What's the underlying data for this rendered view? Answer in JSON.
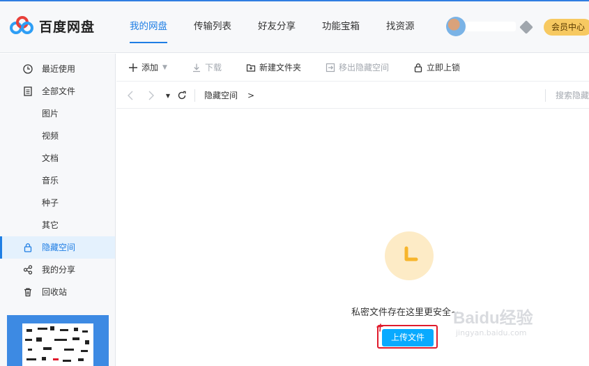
{
  "app": {
    "name": "百度网盘"
  },
  "nav": {
    "tabs": [
      {
        "label": "我的网盘",
        "active": true
      },
      {
        "label": "传输列表",
        "active": false
      },
      {
        "label": "好友分享",
        "active": false
      },
      {
        "label": "功能宝箱",
        "active": false
      },
      {
        "label": "找资源",
        "active": false
      }
    ],
    "vip_label": "会员中心"
  },
  "sidebar": {
    "items": [
      {
        "label": "最近使用",
        "icon": "clock-icon"
      },
      {
        "label": "全部文件",
        "icon": "document-icon"
      },
      {
        "label": "图片"
      },
      {
        "label": "视频"
      },
      {
        "label": "文档"
      },
      {
        "label": "音乐"
      },
      {
        "label": "种子"
      },
      {
        "label": "其它"
      },
      {
        "label": "隐藏空间",
        "icon": "lock-icon",
        "active": true
      },
      {
        "label": "我的分享",
        "icon": "share-icon"
      },
      {
        "label": "回收站",
        "icon": "trash-icon"
      }
    ]
  },
  "toolbar": {
    "add": "添加",
    "download": "下载",
    "new_folder": "新建文件夹",
    "move_out": "移出隐藏空间",
    "lock_now": "立即上锁"
  },
  "path": {
    "current": "隐藏空间",
    "separator": ">",
    "search_placeholder": "搜索隐藏"
  },
  "empty_state": {
    "message": "私密文件存在这里更安全~",
    "upload_label": "上传文件"
  },
  "watermark": {
    "brand": "Baidu经验",
    "url": "jingyan.baidu.com"
  },
  "colors": {
    "accent": "#1f7ee4",
    "upload_button": "#09aaff",
    "vip": "#f7c961",
    "annotation": "#e01a2c"
  }
}
